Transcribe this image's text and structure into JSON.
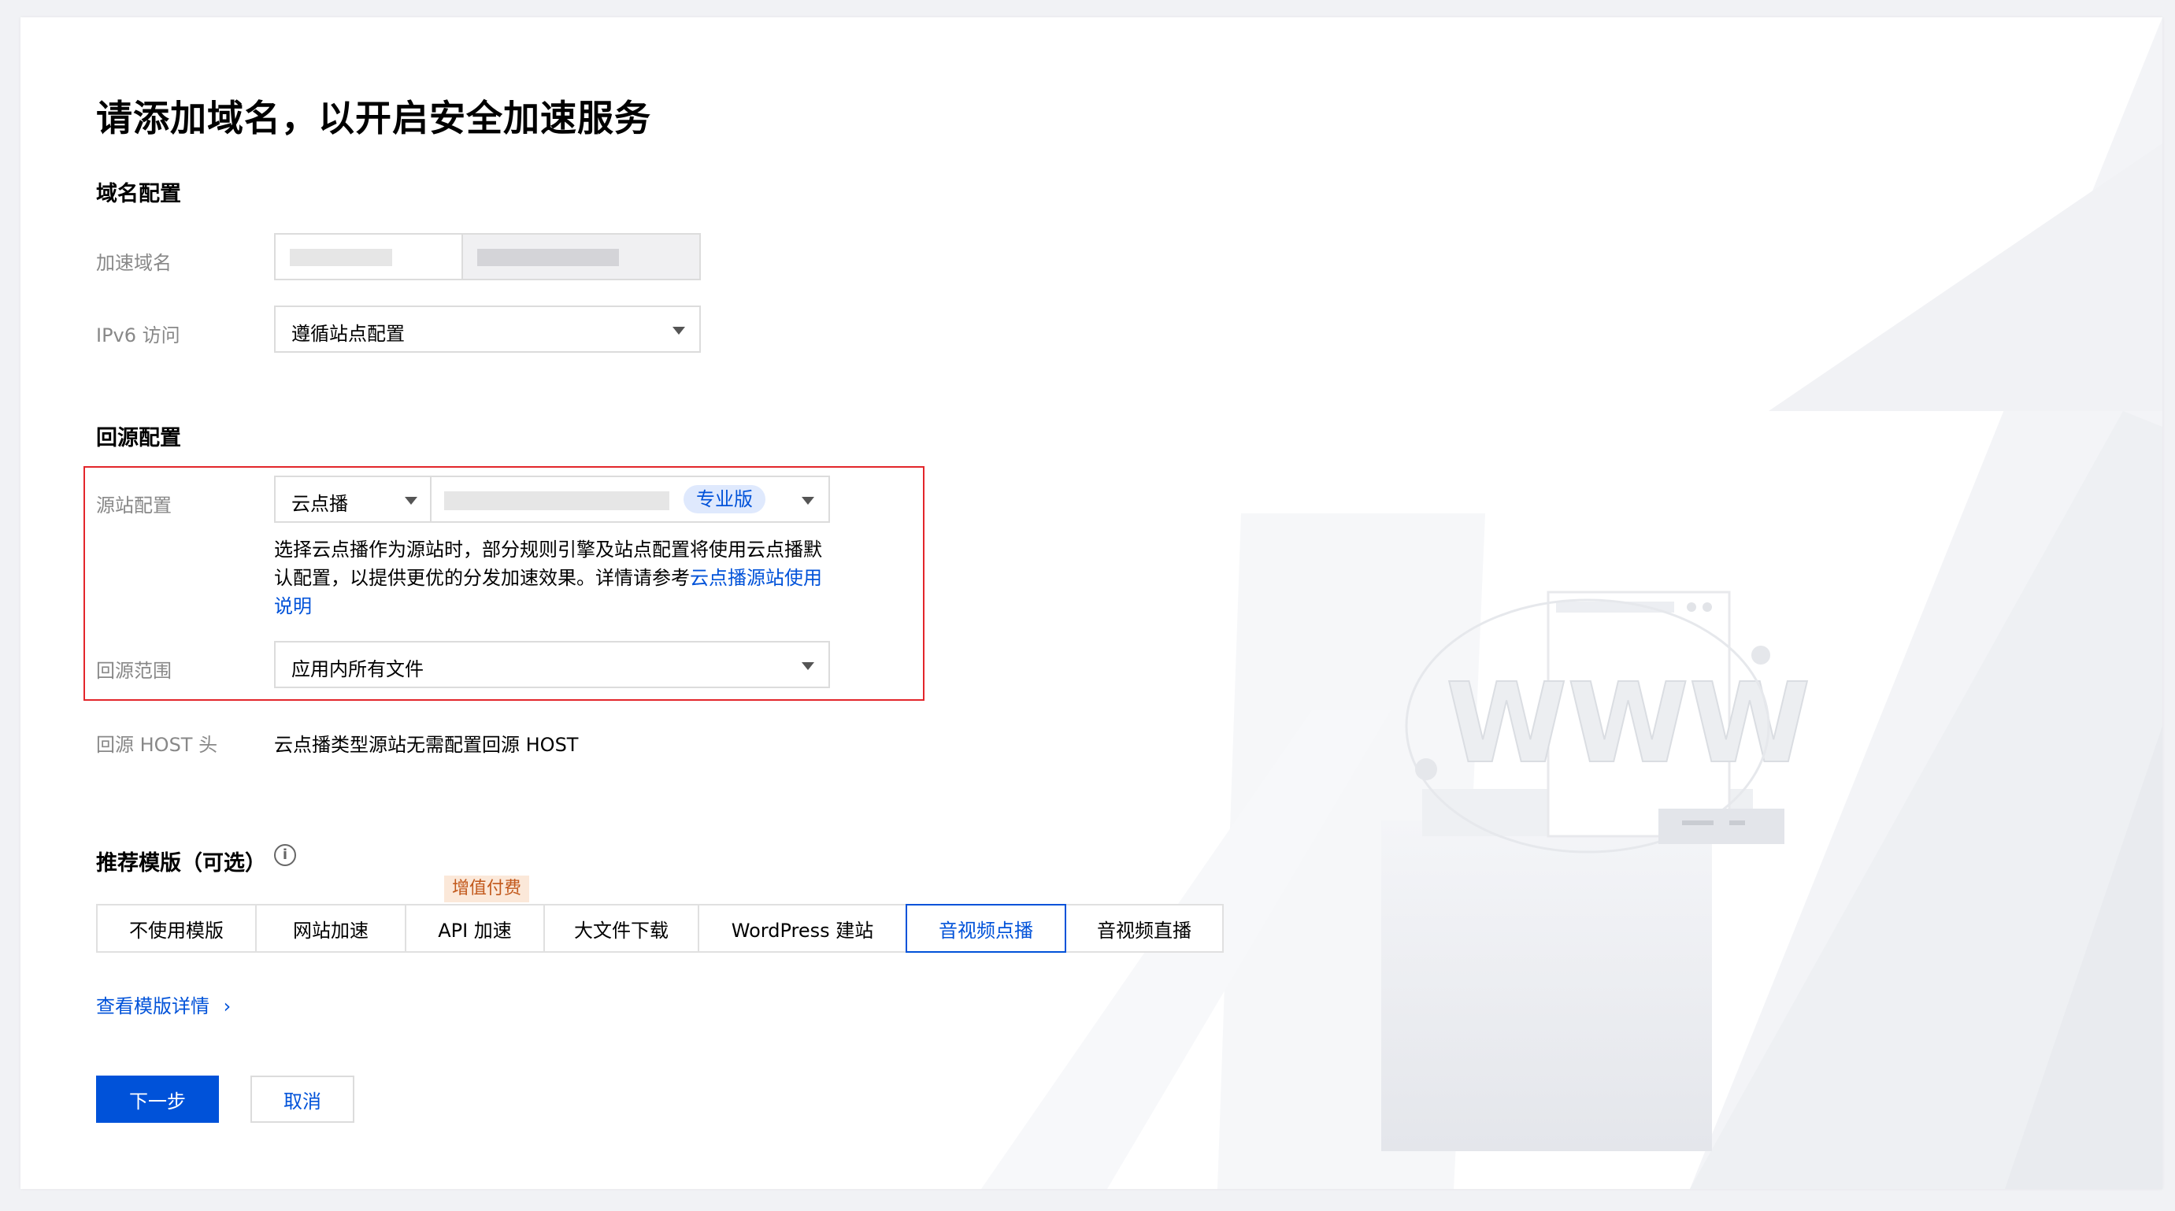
{
  "page_title": "请添加域名，以开启安全加速服务",
  "domain_config": {
    "section_title": "域名配置",
    "accel_domain_label": "加速域名",
    "ipv6_label": "IPv6 访问",
    "ipv6_value": "遵循站点配置"
  },
  "origin_config": {
    "section_title": "回源配置",
    "origin_label": "源站配置",
    "origin_type": "云点播",
    "edition_tag": "专业版",
    "desc_text": "选择云点播作为源站时，部分规则引擎及站点配置将使用云点播默认配置，以提供更优的分发加速效果。详情请参考",
    "desc_link": "云点播源站使用说明",
    "range_label": "回源范围",
    "range_value": "应用内所有文件",
    "host_label": "回源 HOST 头",
    "host_value": "云点播类型源站无需配置回源 HOST"
  },
  "template": {
    "section_title": "推荐模版（可选）",
    "info_icon": "info-circle-icon",
    "badge": "增值付费",
    "tabs": [
      "不使用模版",
      "网站加速",
      "API 加速",
      "大文件下载",
      "WordPress 建站",
      "音视频点播",
      "音视频直播"
    ],
    "active_tab": "音视频点播",
    "detail_link": "查看模版详情",
    "detail_chevron": "›"
  },
  "buttons": {
    "next": "下一步",
    "cancel": "取消"
  },
  "illustration": {
    "text": "WWW"
  },
  "colors": {
    "accent": "#0052d9",
    "highlight_border": "#e3262b",
    "badge_bg": "#fbe8d9",
    "badge_text": "#c2581b"
  }
}
